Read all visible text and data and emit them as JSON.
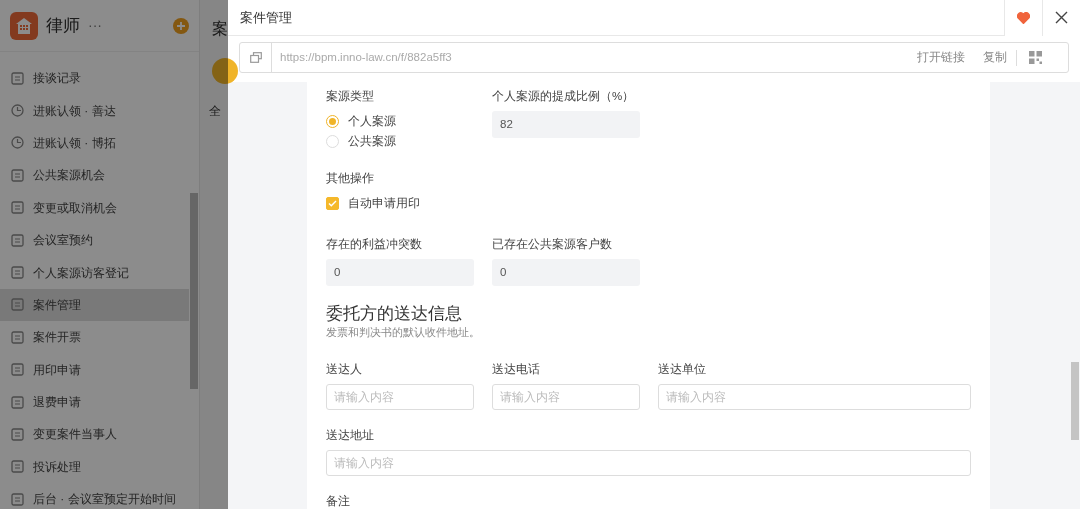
{
  "sidebar": {
    "app_name": "律师",
    "more": "···",
    "items": [
      {
        "label": "接谈记录",
        "kind": "form",
        "selected": false
      },
      {
        "label": "进账认领 · 善达",
        "kind": "clock",
        "selected": false
      },
      {
        "label": "进账认领 · 博拓",
        "kind": "clock",
        "selected": false
      },
      {
        "label": "公共案源机会",
        "kind": "form",
        "selected": false
      },
      {
        "label": "变更或取消机会",
        "kind": "form",
        "selected": false
      },
      {
        "label": "会议室预约",
        "kind": "form",
        "selected": false
      },
      {
        "label": "个人案源访客登记",
        "kind": "form",
        "selected": false
      },
      {
        "label": "案件管理",
        "kind": "form",
        "selected": true
      },
      {
        "label": "案件开票",
        "kind": "form",
        "selected": false
      },
      {
        "label": "用印申请",
        "kind": "form",
        "selected": false
      },
      {
        "label": "退费申请",
        "kind": "form",
        "selected": false
      },
      {
        "label": "变更案件当事人",
        "kind": "form",
        "selected": false
      },
      {
        "label": "投诉处理",
        "kind": "form",
        "selected": false
      },
      {
        "label": "后台 · 会议室预定开始时间",
        "kind": "form",
        "selected": false
      }
    ]
  },
  "background_page": {
    "title_fragment": "案",
    "filter_fragment": "全"
  },
  "drawer": {
    "title": "案件管理",
    "favorited": true,
    "url_bar": {
      "url": "https://bpm.inno-law.cn/f/882a5ff3",
      "open_link": "打开链接",
      "copy": "复制"
    },
    "form": {
      "case_source": {
        "label": "案源类型",
        "options": [
          {
            "label": "个人案源",
            "selected": true
          },
          {
            "label": "公共案源",
            "selected": false
          }
        ]
      },
      "commission": {
        "label": "个人案源的提成比例（%）",
        "value": "82"
      },
      "other": {
        "label": "其他操作",
        "checkbox": {
          "label": "自动申请用印",
          "checked": true
        }
      },
      "conflicts": {
        "label": "存在的利益冲突数",
        "value": "0"
      },
      "public_clients": {
        "label": "已存在公共案源客户数",
        "value": "0"
      },
      "delivery": {
        "title": "委托方的送达信息",
        "subtitle": "发票和判决书的默认收件地址。",
        "rows": [
          [
            {
              "label": "送达人",
              "placeholder": "请输入内容"
            },
            {
              "label": "送达电话",
              "placeholder": "请输入内容"
            },
            {
              "label": "送达单位",
              "placeholder": "请输入内容"
            }
          ],
          [
            {
              "label": "送达地址",
              "placeholder": "请输入内容"
            }
          ]
        ]
      },
      "remarks": {
        "label": "备注"
      }
    }
  }
}
